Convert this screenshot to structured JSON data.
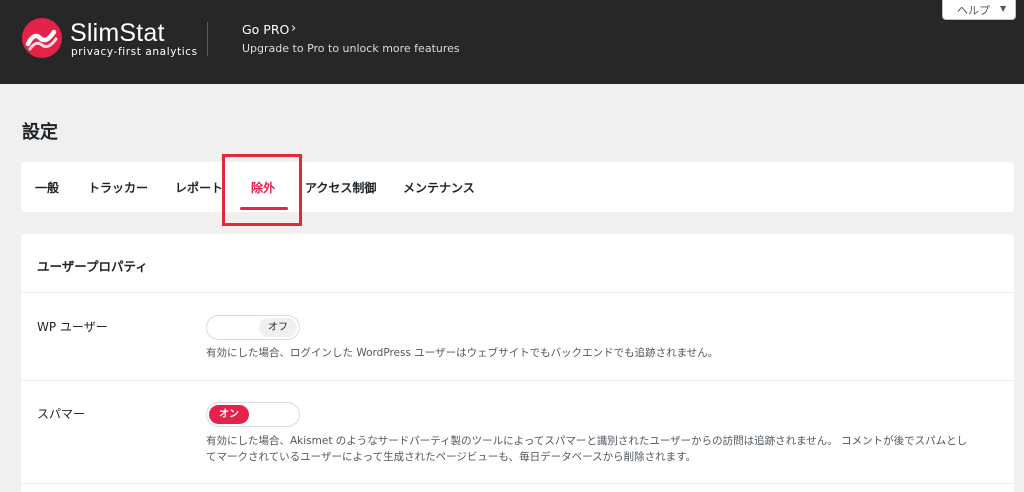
{
  "header": {
    "logo_name": "SlimStat",
    "logo_tagline": "privacy-first analytics",
    "gopro_title": "Go PRO",
    "gopro_chevron": "›",
    "gopro_subtitle": "Upgrade to Pro to unlock more features",
    "help_label": "ヘルプ",
    "help_arrow": "▼"
  },
  "page": {
    "title": "設定"
  },
  "tabs": [
    {
      "label": "一般",
      "active": false
    },
    {
      "label": "トラッカー",
      "active": false
    },
    {
      "label": "レポート",
      "active": false
    },
    {
      "label": "除外",
      "active": true
    },
    {
      "label": "アクセス制御",
      "active": false
    },
    {
      "label": "メンテナンス",
      "active": false
    }
  ],
  "section": {
    "title": "ユーザープロパティ",
    "rows": [
      {
        "label": "WP ユーザー",
        "toggle_state": "off",
        "toggle_label": "オフ",
        "description": "有効にした場合、ログインした WordPress ユーザーはウェブサイトでもバックエンドでも追跡されません。"
      },
      {
        "label": "スパマー",
        "toggle_state": "on",
        "toggle_label": "オン",
        "description_line1": "有効にした場合、Akismet のようなサードパーティ製のツールによってスパマーと識別されたユーザーからの訪問は追跡されません。 コメントが後でスパムとし",
        "description_line2": "てマークされているユーザーによって生成されたページビューも、毎日データベースから削除されます。"
      }
    ]
  },
  "colors": {
    "accent": "#e5234a",
    "header_bg": "#272727",
    "page_bg": "#f0f0f1",
    "highlight": "#e02b37"
  }
}
